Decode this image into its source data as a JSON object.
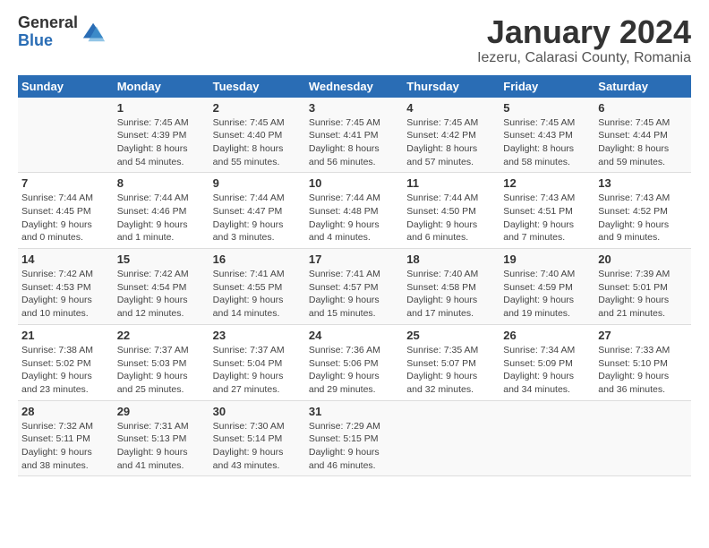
{
  "logo": {
    "general": "General",
    "blue": "Blue"
  },
  "title": "January 2024",
  "subtitle": "Iezeru, Calarasi County, Romania",
  "weekdays": [
    "Sunday",
    "Monday",
    "Tuesday",
    "Wednesday",
    "Thursday",
    "Friday",
    "Saturday"
  ],
  "weeks": [
    [
      {
        "day": "",
        "info": ""
      },
      {
        "day": "1",
        "info": "Sunrise: 7:45 AM\nSunset: 4:39 PM\nDaylight: 8 hours\nand 54 minutes."
      },
      {
        "day": "2",
        "info": "Sunrise: 7:45 AM\nSunset: 4:40 PM\nDaylight: 8 hours\nand 55 minutes."
      },
      {
        "day": "3",
        "info": "Sunrise: 7:45 AM\nSunset: 4:41 PM\nDaylight: 8 hours\nand 56 minutes."
      },
      {
        "day": "4",
        "info": "Sunrise: 7:45 AM\nSunset: 4:42 PM\nDaylight: 8 hours\nand 57 minutes."
      },
      {
        "day": "5",
        "info": "Sunrise: 7:45 AM\nSunset: 4:43 PM\nDaylight: 8 hours\nand 58 minutes."
      },
      {
        "day": "6",
        "info": "Sunrise: 7:45 AM\nSunset: 4:44 PM\nDaylight: 8 hours\nand 59 minutes."
      }
    ],
    [
      {
        "day": "7",
        "info": "Sunrise: 7:44 AM\nSunset: 4:45 PM\nDaylight: 9 hours\nand 0 minutes."
      },
      {
        "day": "8",
        "info": "Sunrise: 7:44 AM\nSunset: 4:46 PM\nDaylight: 9 hours\nand 1 minute."
      },
      {
        "day": "9",
        "info": "Sunrise: 7:44 AM\nSunset: 4:47 PM\nDaylight: 9 hours\nand 3 minutes."
      },
      {
        "day": "10",
        "info": "Sunrise: 7:44 AM\nSunset: 4:48 PM\nDaylight: 9 hours\nand 4 minutes."
      },
      {
        "day": "11",
        "info": "Sunrise: 7:44 AM\nSunset: 4:50 PM\nDaylight: 9 hours\nand 6 minutes."
      },
      {
        "day": "12",
        "info": "Sunrise: 7:43 AM\nSunset: 4:51 PM\nDaylight: 9 hours\nand 7 minutes."
      },
      {
        "day": "13",
        "info": "Sunrise: 7:43 AM\nSunset: 4:52 PM\nDaylight: 9 hours\nand 9 minutes."
      }
    ],
    [
      {
        "day": "14",
        "info": "Sunrise: 7:42 AM\nSunset: 4:53 PM\nDaylight: 9 hours\nand 10 minutes."
      },
      {
        "day": "15",
        "info": "Sunrise: 7:42 AM\nSunset: 4:54 PM\nDaylight: 9 hours\nand 12 minutes."
      },
      {
        "day": "16",
        "info": "Sunrise: 7:41 AM\nSunset: 4:55 PM\nDaylight: 9 hours\nand 14 minutes."
      },
      {
        "day": "17",
        "info": "Sunrise: 7:41 AM\nSunset: 4:57 PM\nDaylight: 9 hours\nand 15 minutes."
      },
      {
        "day": "18",
        "info": "Sunrise: 7:40 AM\nSunset: 4:58 PM\nDaylight: 9 hours\nand 17 minutes."
      },
      {
        "day": "19",
        "info": "Sunrise: 7:40 AM\nSunset: 4:59 PM\nDaylight: 9 hours\nand 19 minutes."
      },
      {
        "day": "20",
        "info": "Sunrise: 7:39 AM\nSunset: 5:01 PM\nDaylight: 9 hours\nand 21 minutes."
      }
    ],
    [
      {
        "day": "21",
        "info": "Sunrise: 7:38 AM\nSunset: 5:02 PM\nDaylight: 9 hours\nand 23 minutes."
      },
      {
        "day": "22",
        "info": "Sunrise: 7:37 AM\nSunset: 5:03 PM\nDaylight: 9 hours\nand 25 minutes."
      },
      {
        "day": "23",
        "info": "Sunrise: 7:37 AM\nSunset: 5:04 PM\nDaylight: 9 hours\nand 27 minutes."
      },
      {
        "day": "24",
        "info": "Sunrise: 7:36 AM\nSunset: 5:06 PM\nDaylight: 9 hours\nand 29 minutes."
      },
      {
        "day": "25",
        "info": "Sunrise: 7:35 AM\nSunset: 5:07 PM\nDaylight: 9 hours\nand 32 minutes."
      },
      {
        "day": "26",
        "info": "Sunrise: 7:34 AM\nSunset: 5:09 PM\nDaylight: 9 hours\nand 34 minutes."
      },
      {
        "day": "27",
        "info": "Sunrise: 7:33 AM\nSunset: 5:10 PM\nDaylight: 9 hours\nand 36 minutes."
      }
    ],
    [
      {
        "day": "28",
        "info": "Sunrise: 7:32 AM\nSunset: 5:11 PM\nDaylight: 9 hours\nand 38 minutes."
      },
      {
        "day": "29",
        "info": "Sunrise: 7:31 AM\nSunset: 5:13 PM\nDaylight: 9 hours\nand 41 minutes."
      },
      {
        "day": "30",
        "info": "Sunrise: 7:30 AM\nSunset: 5:14 PM\nDaylight: 9 hours\nand 43 minutes."
      },
      {
        "day": "31",
        "info": "Sunrise: 7:29 AM\nSunset: 5:15 PM\nDaylight: 9 hours\nand 46 minutes."
      },
      {
        "day": "",
        "info": ""
      },
      {
        "day": "",
        "info": ""
      },
      {
        "day": "",
        "info": ""
      }
    ]
  ]
}
